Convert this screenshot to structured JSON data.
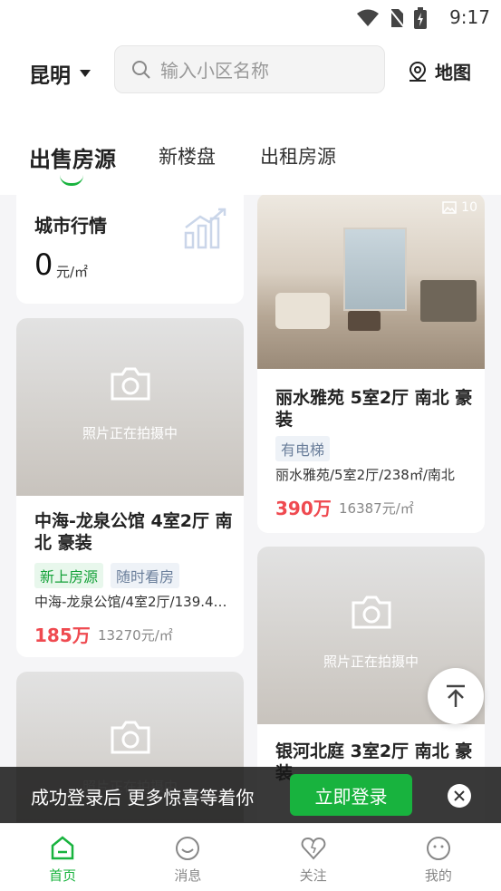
{
  "status": {
    "time": "9:17"
  },
  "header": {
    "city": "昆明",
    "search_placeholder": "输入小区名称",
    "map_label": "地图"
  },
  "tabs": [
    {
      "label": "出售房源",
      "active": true
    },
    {
      "label": "新楼盘"
    },
    {
      "label": "出租房源"
    }
  ],
  "market": {
    "title": "城市行情",
    "value": "0",
    "unit": "元/㎡"
  },
  "placeholder_text": "照片正在拍摄中",
  "listings": [
    {
      "title": "中海-龙泉公馆 4室2厅 南北 豪装",
      "tags": [
        "新上房源",
        "随时看房"
      ],
      "desc": "中海-龙泉公馆/4室2厅/139.4…",
      "price": "185万",
      "unit_price": "13270元/㎡"
    },
    {
      "title": "丽水雅苑 5室2厅 南北 豪装",
      "tags": [
        "有电梯"
      ],
      "desc": "丽水雅苑/5室2厅/238㎡/南北",
      "price": "390万",
      "unit_price": "16387元/㎡",
      "photo_count": "10"
    },
    {
      "title": "银河北庭 3室2厅 南北 豪装"
    }
  ],
  "banner": {
    "message": "成功登录后 更多惊喜等着你",
    "button": "立即登录"
  },
  "nav": [
    {
      "label": "首页",
      "icon": "home-icon",
      "active": true
    },
    {
      "label": "消息",
      "icon": "message-icon"
    },
    {
      "label": "关注",
      "icon": "heart-icon"
    },
    {
      "label": "我的",
      "icon": "profile-icon"
    }
  ],
  "colors": {
    "accent": "#18b33e",
    "price": "#ef4a50"
  }
}
